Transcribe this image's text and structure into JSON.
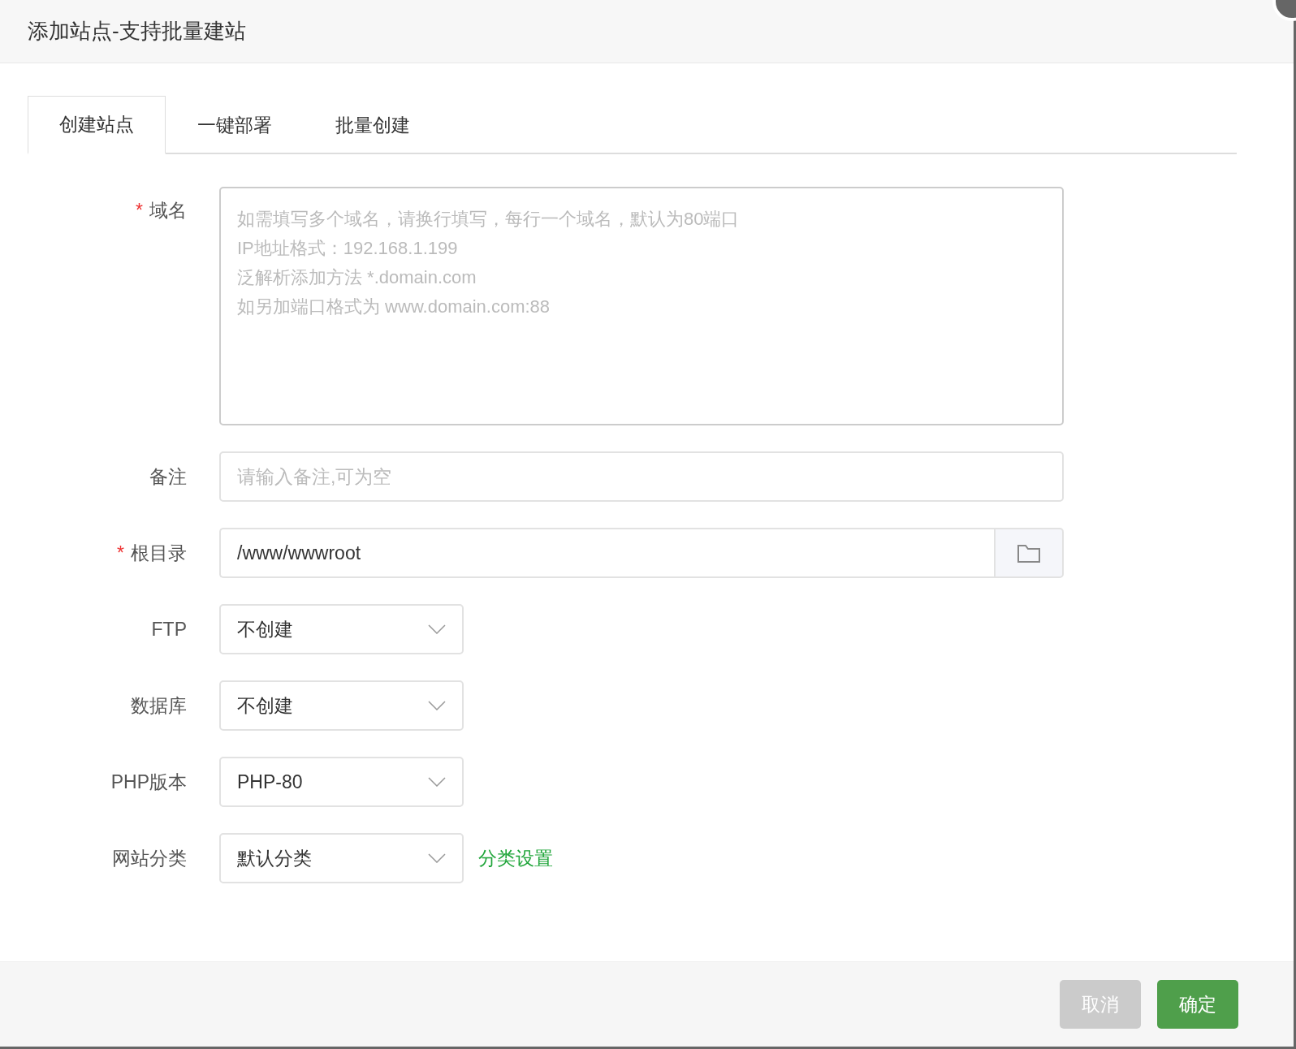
{
  "window": {
    "title": "添加站点-支持批量建站"
  },
  "tabs": [
    {
      "label": "创建站点",
      "selected": true
    },
    {
      "label": "一键部署",
      "selected": false
    },
    {
      "label": "批量创建",
      "selected": false
    }
  ],
  "fields": [
    {
      "kind": "textarea",
      "label": "域名",
      "marker": "*",
      "placeholder": "如需填写多个域名，请换行填写，每行一个域名，默认为80端口\nIP地址格式：192.168.1.199\n泛解析添加方法 *.domain.com\n如另加端口格式为 www.domain.com:88"
    },
    {
      "kind": "input",
      "label": "备注",
      "placeholder": "请输入备注,可为空"
    },
    {
      "kind": "path",
      "label": "根目录",
      "marker": "*",
      "value": "/www/wwwroot"
    },
    {
      "kind": "select",
      "label": "FTP",
      "value": "不创建"
    },
    {
      "kind": "select",
      "label": "数据库",
      "value": "不创建"
    },
    {
      "kind": "select",
      "label": "PHP版本",
      "value": "PHP-80"
    },
    {
      "kind": "select",
      "label": "网站分类",
      "value": "默认分类",
      "link": "分类设置"
    }
  ],
  "buttons": [
    {
      "label": "取消",
      "kind": "secondary"
    },
    {
      "label": "确定",
      "kind": "primary"
    }
  ]
}
